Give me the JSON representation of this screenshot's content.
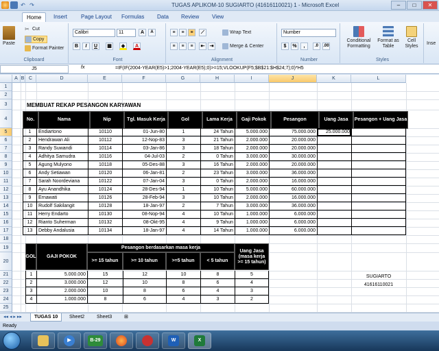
{
  "window": {
    "title": "TUGAS APLIKOM-10 SUGIARTO (41616110021) 1 - Microsoft Excel"
  },
  "ribbon": {
    "tabs": [
      "Home",
      "Insert",
      "Page Layout",
      "Formulas",
      "Data",
      "Review",
      "View"
    ],
    "clipboard": {
      "paste": "Paste",
      "cut": "Cut",
      "copy": "Copy",
      "format_painter": "Format Painter",
      "label": "Clipboard"
    },
    "font": {
      "name": "Calibri",
      "size": "11",
      "label": "Font"
    },
    "alignment": {
      "wrap": "Wrap Text",
      "merge": "Merge & Center",
      "label": "Alignment"
    },
    "number": {
      "format": "Number",
      "label": "Number"
    },
    "styles": {
      "conditional": "Conditional Formatting",
      "table": "Format as Table",
      "cell": "Cell Styles",
      "label": "Styles"
    },
    "insert": "Inse"
  },
  "formula_bar": {
    "name_box": "J5",
    "fx": "fx",
    "formula": "=IF(IF(2004-YEAR(E5)>1;2004-YEAR(E5);0)>=15;VLOOKUP(F5;$B$21:$H$24;7);0)*H5"
  },
  "columns": [
    "A",
    "B",
    "C",
    "D",
    "E",
    "F",
    "G",
    "H",
    "I",
    "J",
    "K",
    "L"
  ],
  "rows": [
    "1",
    "2",
    "3",
    "4",
    "5",
    "6",
    "7",
    "8",
    "9",
    "10",
    "11",
    "12",
    "13",
    "14",
    "15",
    "16",
    "17",
    "18",
    "19",
    "20",
    "21",
    "22",
    "23",
    "24",
    "25",
    "26"
  ],
  "sheet": {
    "heading": "MEMBUAT REKAP PESANGON KARYAWAN",
    "headers": [
      "No.",
      "Nama",
      "Nip",
      "Tgl. Masuk Kerja",
      "Gol",
      "Lama Kerja",
      "Gaji Pokok",
      "Pesangon",
      "Uang Jasa",
      "Pesangon + Uang Jasa"
    ],
    "employees": [
      [
        "1",
        "Endiartono",
        "10110",
        "01-Jun-80",
        "1",
        "24 Tahun",
        "5.000.000",
        "75.000.000",
        "25.000.000"
      ],
      [
        "2",
        "Hendrawan Ali",
        "10112",
        "12-Nop-83",
        "3",
        "21 Tahun",
        "2.000.000",
        "20.000.000",
        ""
      ],
      [
        "3",
        "Randy Suwandi",
        "10114",
        "03-Jan-86",
        "3",
        "18 Tahun",
        "2.000.000",
        "20.000.000",
        ""
      ],
      [
        "4",
        "Adhitya Samudra",
        "10116",
        "04-Jul-03",
        "2",
        "0 Tahun",
        "3.000.000",
        "30.000.000",
        ""
      ],
      [
        "5",
        "Agung Mulyono",
        "10118",
        "05-Des-88",
        "3",
        "16 Tahun",
        "2.000.000",
        "20.000.000",
        ""
      ],
      [
        "6",
        "Andy Setiawan",
        "10120",
        "06-Jan-81",
        "2",
        "23 Tahun",
        "3.000.000",
        "36.000.000",
        ""
      ],
      [
        "7",
        "Sarah Noordeviana",
        "10122",
        "07-Jan-04",
        "3",
        "0 Tahun",
        "2.000.000",
        "16.000.000",
        ""
      ],
      [
        "8",
        "Ayu Anandhika",
        "10124",
        "28-Des-94",
        "1",
        "10 Tahun",
        "5.000.000",
        "60.000.000",
        ""
      ],
      [
        "9",
        "Ernawati",
        "10126",
        "28-Feb-94",
        "3",
        "10 Tahun",
        "2.000.000",
        "16.000.000",
        ""
      ],
      [
        "10",
        "Rudolf Sakilangit",
        "10128",
        "18-Jan-97",
        "2",
        "7 Tahun",
        "3.000.000",
        "36.000.000",
        ""
      ],
      [
        "11",
        "Herry Endarto",
        "10130",
        "08-Nop-94",
        "4",
        "10 Tahun",
        "1.000.000",
        "6.000.000",
        ""
      ],
      [
        "12",
        "Rianto Suherman",
        "10132",
        "08-Okt-95",
        "4",
        "9 Tahun",
        "1.000.000",
        "6.000.000",
        ""
      ],
      [
        "13",
        "Debby Andalusia",
        "10134",
        "18-Jan-97",
        "4",
        "14 Tahun",
        "1.000.000",
        "6.000.000",
        ""
      ]
    ],
    "table2": {
      "gol": "GOL",
      "gaji": "GAJI POKOK",
      "pesangon_header": "Pesangon berdasarkan masa kerja",
      "sub": [
        ">= 15 tahun",
        ">= 10 tahun",
        ">=5 tahun",
        "< 5 tahun"
      ],
      "uang_jasa": "Uang Jasa (masa kerja >= 15 tahun)",
      "rows": [
        [
          "1",
          "5.000.000",
          "15",
          "12",
          "10",
          "8",
          "5"
        ],
        [
          "2",
          "3.000.000",
          "12",
          "10",
          "8",
          "6",
          "4"
        ],
        [
          "3",
          "2.000.000",
          "10",
          "8",
          "6",
          "4",
          "3"
        ],
        [
          "4",
          "1.000.000",
          "8",
          "6",
          "4",
          "3",
          "2"
        ]
      ]
    },
    "author_name": "SUGIARTO",
    "author_nim": "41616110021"
  },
  "sheet_tabs": [
    "TUGAS 10",
    "Sheet2",
    "Sheet3"
  ],
  "status": "Ready"
}
